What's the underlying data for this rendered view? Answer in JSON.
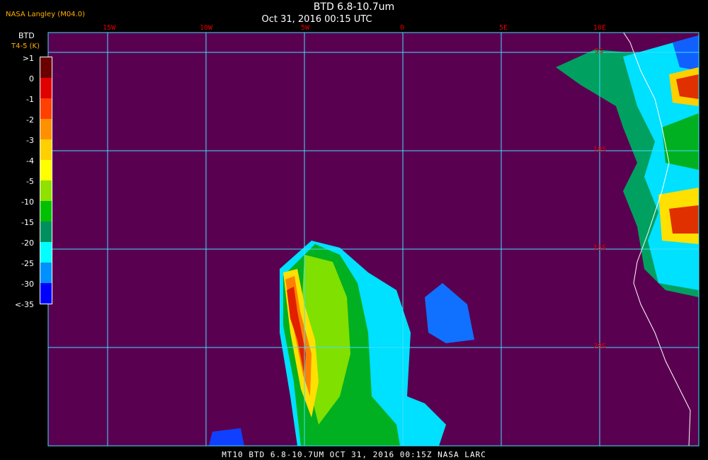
{
  "header": {
    "title": "BTD 6.8-10.7um",
    "date": "Oct 31, 2016 00:15 UTC",
    "producer": "NASA Langley (M04.0)"
  },
  "legend": {
    "title": "BTD",
    "unit": "T4-5 (K)",
    "labels": [
      ">1",
      "0",
      "-1",
      "-2",
      "-3",
      "-4",
      "-5",
      "-10",
      "-15",
      "-20",
      "-25",
      "-30",
      "<-35"
    ],
    "colors": [
      "#6a0000",
      "#e00000",
      "#ff4000",
      "#ff9000",
      "#ffd000",
      "#ffff00",
      "#90e000",
      "#00c000",
      "#009060",
      "#00ffff",
      "#0090ff",
      "#0000ff",
      "#5a0050"
    ]
  },
  "longitude_labels": [
    "15W",
    "10W",
    "5W",
    "0",
    "5E",
    "10E"
  ],
  "latitude_labels": [
    "5S",
    "10S",
    "15S",
    "20S"
  ],
  "footer": "MT10  BTD 6.8-10.7UM   OCT 31, 2016 00:15Z   NASA LARC",
  "colors": {
    "background": "#5a0050",
    "grid": "#40e0ff",
    "coastline": "#ffffff",
    "grid_label": "#dd0000"
  }
}
